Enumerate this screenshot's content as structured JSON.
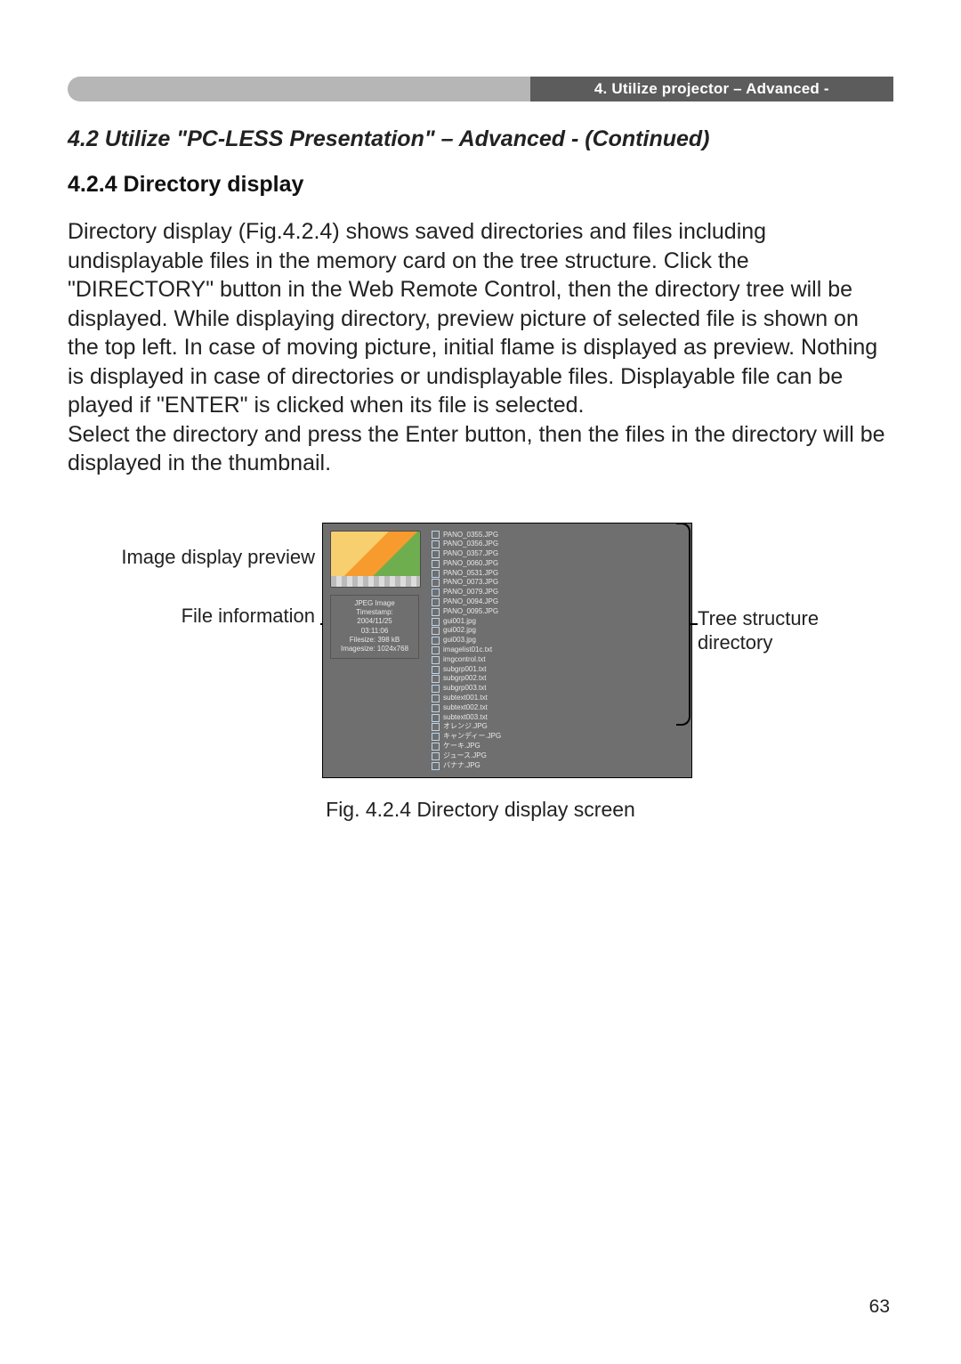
{
  "header": {
    "right": "4. Utilize projector – Advanced -"
  },
  "subsection": "4.2 Utilize \"PC-LESS Presentation\" – Advanced - (Continued)",
  "heading": "4.2.4 Directory display",
  "paragraph1": "Directory display (Fig.4.2.4) shows saved directories and files including undisplayable files in the memory card on the tree structure. Click the \"DIRECTORY\" button in the Web Remote Control, then the directory tree will be displayed. While displaying directory, preview picture of selected file is shown on the top left. In case of moving picture, initial flame is displayed as preview. Nothing is displayed in case of directories or undisplayable files. Displayable file can be played if \"ENTER\" is clicked when its file is selected.",
  "paragraph2": "Select the directory and press the Enter button, then the files in the directory will be displayed in the thumbnail.",
  "labels": {
    "preview": "Image display preview",
    "info": "File information",
    "tree": "Tree structure directory"
  },
  "info_box": "JPEG Image\nTimestamp:\n2004/11/25\n03:11:06\nFilesize: 398 kB\nImagesize: 1024x768",
  "tree_items": [
    "PANO_0355.JPG",
    "PANO_0356.JPG",
    "PANO_0357.JPG",
    "PANO_0060.JPG",
    "PANO_0531.JPG",
    "PANO_0073.JPG",
    "PANO_0079.JPG",
    "PANO_0094.JPG",
    "PANO_0095.JPG",
    "gui001.jpg",
    "gui002.jpg",
    "gui003.jpg",
    "imagelist01c.txt",
    "imgcontrol.txt",
    "subgrp001.txt",
    "subgrp002.txt",
    "subgrp003.txt",
    "subtext001.txt",
    "subtext002.txt",
    "subtext003.txt",
    "オレンジ.JPG",
    "キャンディー.JPG",
    "ケーキ.JPG",
    "ジュース.JPG",
    "バナナ.JPG"
  ],
  "caption": "Fig. 4.2.4 Directory display screen",
  "page_number": "63"
}
